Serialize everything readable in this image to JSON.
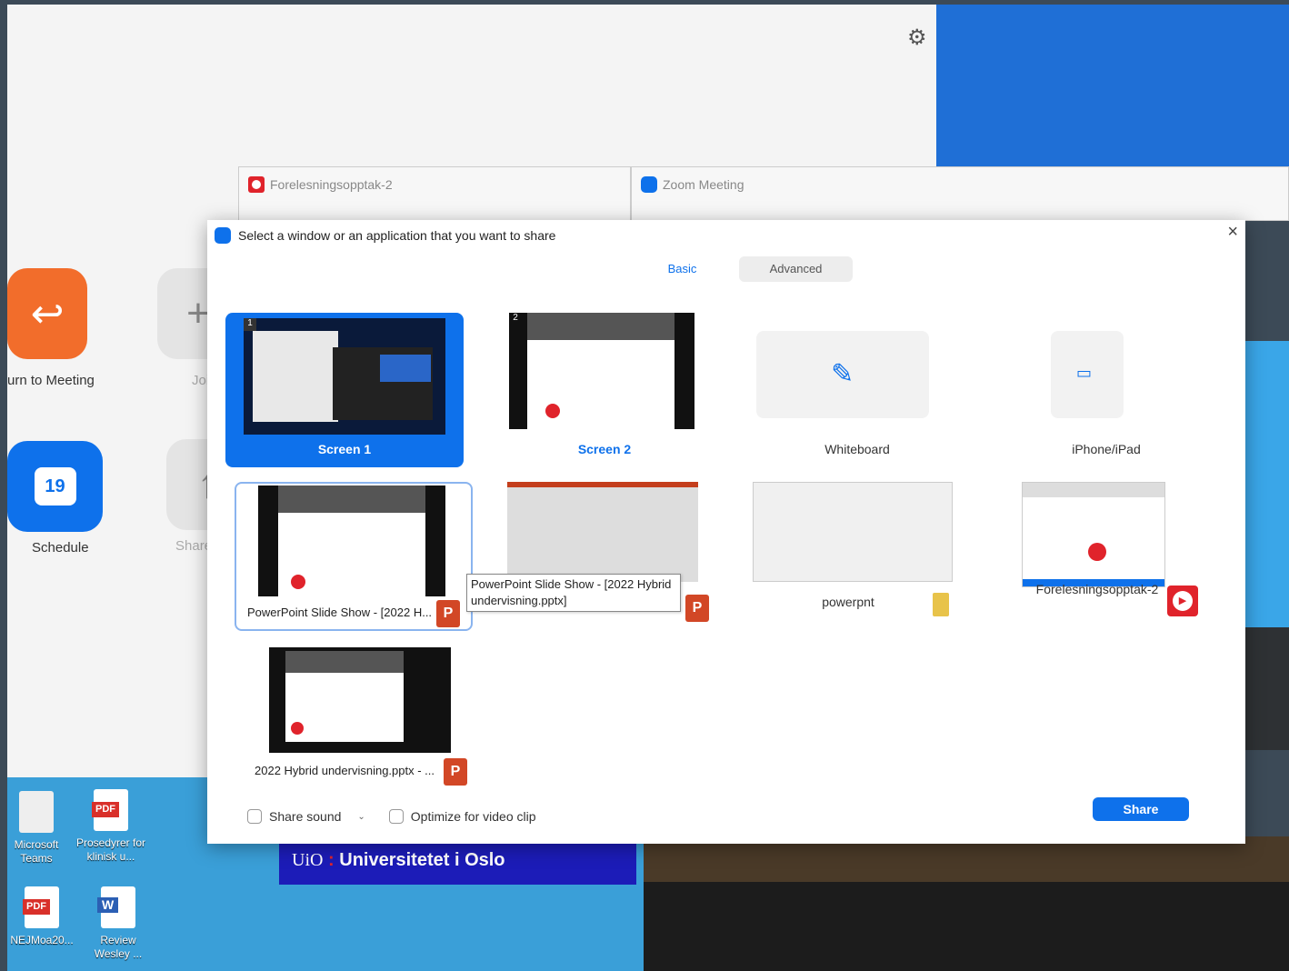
{
  "home": {
    "return_label": "urn to Meeting",
    "join_label": "Join",
    "schedule_label": "Schedule",
    "share_label": "Share sc",
    "calendar_day": "19"
  },
  "desktop_icons": [
    {
      "label": "Microsoft Teams",
      "icon": "teams-icon"
    },
    {
      "label": "Prosedyrer for klinisk u...",
      "icon": "pdf-icon"
    },
    {
      "label": "NEJMoa20...",
      "icon": "pdf-icon"
    },
    {
      "label": "Review Wesley ...",
      "icon": "word-icon"
    }
  ],
  "pdf_text": "PDF",
  "word_text": "W",
  "banner": {
    "prefix": "UiO",
    "sep": ":",
    "name": "Universitetet i Oslo"
  },
  "background_windows": {
    "recording": "Forelesningsopptak-2",
    "zoom": "Zoom Meeting"
  },
  "dialog": {
    "title": "Select a window or an application that you want to share",
    "close": "×",
    "tabs": [
      "Basic",
      "Advanced"
    ],
    "tiles": {
      "screen1": "Screen 1",
      "screen2": "Screen 2",
      "whiteboard": "Whiteboard",
      "iphone": "iPhone/iPad",
      "ppt_show": "PowerPoint Slide Show - [2022 H...",
      "powerpnt": "powerpnt",
      "recording": "Forelesningsopptak-2",
      "pptx": "2022 Hybrid undervisning.pptx - ..."
    },
    "tooltip": "PowerPoint Slide Show - [2022 Hybrid undervisning.pptx]",
    "app_letter": "P",
    "screen_numbers": [
      "1",
      "2"
    ],
    "share_sound": "Share sound",
    "optimize": "Optimize for video clip",
    "share_button": "Share"
  },
  "colors": {
    "zoom_blue": "#0e71eb",
    "orange": "#f26d2b",
    "recording_red": "#e0232b",
    "uio_blue": "#1c1cb8"
  }
}
